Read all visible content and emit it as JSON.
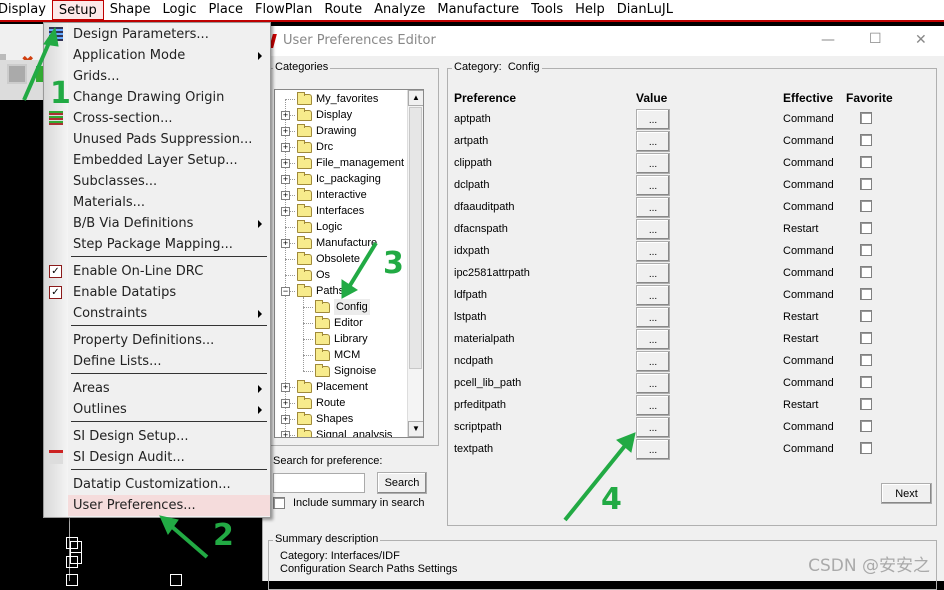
{
  "menubar": {
    "items": [
      {
        "label": "Display",
        "active": false
      },
      {
        "label": "Setup",
        "active": true
      },
      {
        "label": "Shape",
        "active": false
      },
      {
        "label": "Logic",
        "active": false
      },
      {
        "label": "Place",
        "active": false
      },
      {
        "label": "FlowPlan",
        "active": false
      },
      {
        "label": "Route",
        "active": false
      },
      {
        "label": "Analyze",
        "active": false
      },
      {
        "label": "Manufacture",
        "active": false
      },
      {
        "label": "Tools",
        "active": false
      },
      {
        "label": "Help",
        "active": false
      },
      {
        "label": "DianLuJL",
        "active": false
      }
    ]
  },
  "setup_menu": {
    "items": [
      {
        "label": "Design Parameters...",
        "icon": "design-parameters-icon"
      },
      {
        "label": "Application Mode",
        "submenu": true
      },
      {
        "label": "Grids..."
      },
      {
        "label": "Change Drawing Origin"
      },
      {
        "label": "Cross-section...",
        "icon": "cross-section-icon"
      },
      {
        "label": "Unused Pads Suppression..."
      },
      {
        "label": "Embedded Layer Setup..."
      },
      {
        "label": "Subclasses..."
      },
      {
        "label": "Materials..."
      },
      {
        "label": "B/B Via Definitions",
        "submenu": true
      },
      {
        "label": "Step Package Mapping..."
      },
      {
        "label": "Enable On-Line DRC",
        "checked": true
      },
      {
        "label": "Enable Datatips",
        "checked": true
      },
      {
        "label": "Constraints",
        "submenu": true
      },
      {
        "label": "Property Definitions..."
      },
      {
        "label": "Define Lists..."
      },
      {
        "label": "Areas",
        "submenu": true
      },
      {
        "label": "Outlines",
        "submenu": true
      },
      {
        "label": "SI Design Setup..."
      },
      {
        "label": "SI Design Audit...",
        "icon": "si-audit-icon"
      },
      {
        "label": "Datatip Customization..."
      },
      {
        "label": "User Preferences...",
        "highlighted": true
      }
    ]
  },
  "dialog": {
    "title": "User Preferences Editor",
    "categories_label": "Categories",
    "tree": [
      {
        "label": "My_favorites",
        "level": 0,
        "expander": "none"
      },
      {
        "label": "Display",
        "level": 0,
        "expander": "plus"
      },
      {
        "label": "Drawing",
        "level": 0,
        "expander": "plus"
      },
      {
        "label": "Drc",
        "level": 0,
        "expander": "plus"
      },
      {
        "label": "File_management",
        "level": 0,
        "expander": "plus"
      },
      {
        "label": "Ic_packaging",
        "level": 0,
        "expander": "plus"
      },
      {
        "label": "Interactive",
        "level": 0,
        "expander": "plus"
      },
      {
        "label": "Interfaces",
        "level": 0,
        "expander": "plus"
      },
      {
        "label": "Logic",
        "level": 0,
        "expander": "none"
      },
      {
        "label": "Manufacture",
        "level": 0,
        "expander": "plus"
      },
      {
        "label": "Obsolete",
        "level": 0,
        "expander": "none"
      },
      {
        "label": "Os",
        "level": 0,
        "expander": "none"
      },
      {
        "label": "Paths",
        "level": 0,
        "expander": "minus"
      },
      {
        "label": "Config",
        "level": 1,
        "expander": "none",
        "selected": true
      },
      {
        "label": "Editor",
        "level": 1,
        "expander": "none"
      },
      {
        "label": "Library",
        "level": 1,
        "expander": "none"
      },
      {
        "label": "MCM",
        "level": 1,
        "expander": "none"
      },
      {
        "label": "Signoise",
        "level": 1,
        "expander": "none"
      },
      {
        "label": "Placement",
        "level": 0,
        "expander": "plus"
      },
      {
        "label": "Route",
        "level": 0,
        "expander": "plus"
      },
      {
        "label": "Shapes",
        "level": 0,
        "expander": "plus"
      },
      {
        "label": "Signal_analysis",
        "level": 0,
        "expander": "plus"
      }
    ],
    "search": {
      "label": "Search for preference:",
      "value": "",
      "button": "Search",
      "include_summary_label": "Include summary in search",
      "include_summary_checked": false
    },
    "category": {
      "label": "Category:",
      "name": "Config"
    },
    "columns": {
      "preference": "Preference",
      "value": "Value",
      "effective": "Effective",
      "favorite": "Favorite"
    },
    "preferences": [
      {
        "name": "aptpath",
        "value_button": "...",
        "effective": "Command",
        "favorite": false
      },
      {
        "name": "artpath",
        "value_button": "...",
        "effective": "Command",
        "favorite": false
      },
      {
        "name": "clippath",
        "value_button": "...",
        "effective": "Command",
        "favorite": false
      },
      {
        "name": "dclpath",
        "value_button": "...",
        "effective": "Command",
        "favorite": false
      },
      {
        "name": "dfaauditpath",
        "value_button": "...",
        "effective": "Command",
        "favorite": false
      },
      {
        "name": "dfacnspath",
        "value_button": "...",
        "effective": "Restart",
        "favorite": false
      },
      {
        "name": "idxpath",
        "value_button": "...",
        "effective": "Command",
        "favorite": false
      },
      {
        "name": "ipc2581attrpath",
        "value_button": "...",
        "effective": "Command",
        "favorite": false
      },
      {
        "name": "ldfpath",
        "value_button": "...",
        "effective": "Command",
        "favorite": false
      },
      {
        "name": "lstpath",
        "value_button": "...",
        "effective": "Restart",
        "favorite": false
      },
      {
        "name": "materialpath",
        "value_button": "...",
        "effective": "Restart",
        "favorite": false
      },
      {
        "name": "ncdpath",
        "value_button": "...",
        "effective": "Command",
        "favorite": false
      },
      {
        "name": "pcell_lib_path",
        "value_button": "...",
        "effective": "Command",
        "favorite": false
      },
      {
        "name": "prfeditpath",
        "value_button": "...",
        "effective": "Restart",
        "favorite": false
      },
      {
        "name": "scriptpath",
        "value_button": "...",
        "effective": "Command",
        "favorite": false
      },
      {
        "name": "textpath",
        "value_button": "...",
        "effective": "Command",
        "favorite": false
      }
    ],
    "next_button": "Next",
    "summary": {
      "label": "Summary description",
      "line1": "Category: Interfaces/IDF",
      "line2": "Configuration Search Paths Settings"
    }
  },
  "annotations": [
    "1",
    "2",
    "3",
    "4"
  ],
  "annotation_color": "#22aa44",
  "watermark": "CSDN @安安之"
}
